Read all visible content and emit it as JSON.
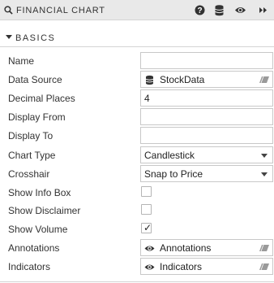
{
  "header": {
    "title": "FINANCIAL CHART",
    "icons": [
      "search-icon",
      "help-icon",
      "database-icon",
      "eye-icon",
      "expand-icon"
    ]
  },
  "section": {
    "label": "BASICS"
  },
  "properties": {
    "name": {
      "label": "Name",
      "value": ""
    },
    "data_source": {
      "label": "Data Source",
      "value": "StockData"
    },
    "decimal_places": {
      "label": "Decimal Places",
      "value": "4"
    },
    "display_from": {
      "label": "Display From",
      "value": ""
    },
    "display_to": {
      "label": "Display To",
      "value": ""
    },
    "chart_type": {
      "label": "Chart Type",
      "value": "Candlestick"
    },
    "crosshair": {
      "label": "Crosshair",
      "value": "Snap to Price"
    },
    "show_info_box": {
      "label": "Show Info Box",
      "checked": false
    },
    "show_disclaimer": {
      "label": "Show Disclaimer",
      "checked": false
    },
    "show_volume": {
      "label": "Show Volume",
      "checked": true,
      "mark": "✓"
    },
    "annotations": {
      "label": "Annotations",
      "value": "Annotations"
    },
    "indicators": {
      "label": "Indicators",
      "value": "Indicators"
    }
  },
  "colors": {
    "header_bg": "#e9e9e9",
    "border": "#c8c8c8",
    "text": "#333333"
  }
}
